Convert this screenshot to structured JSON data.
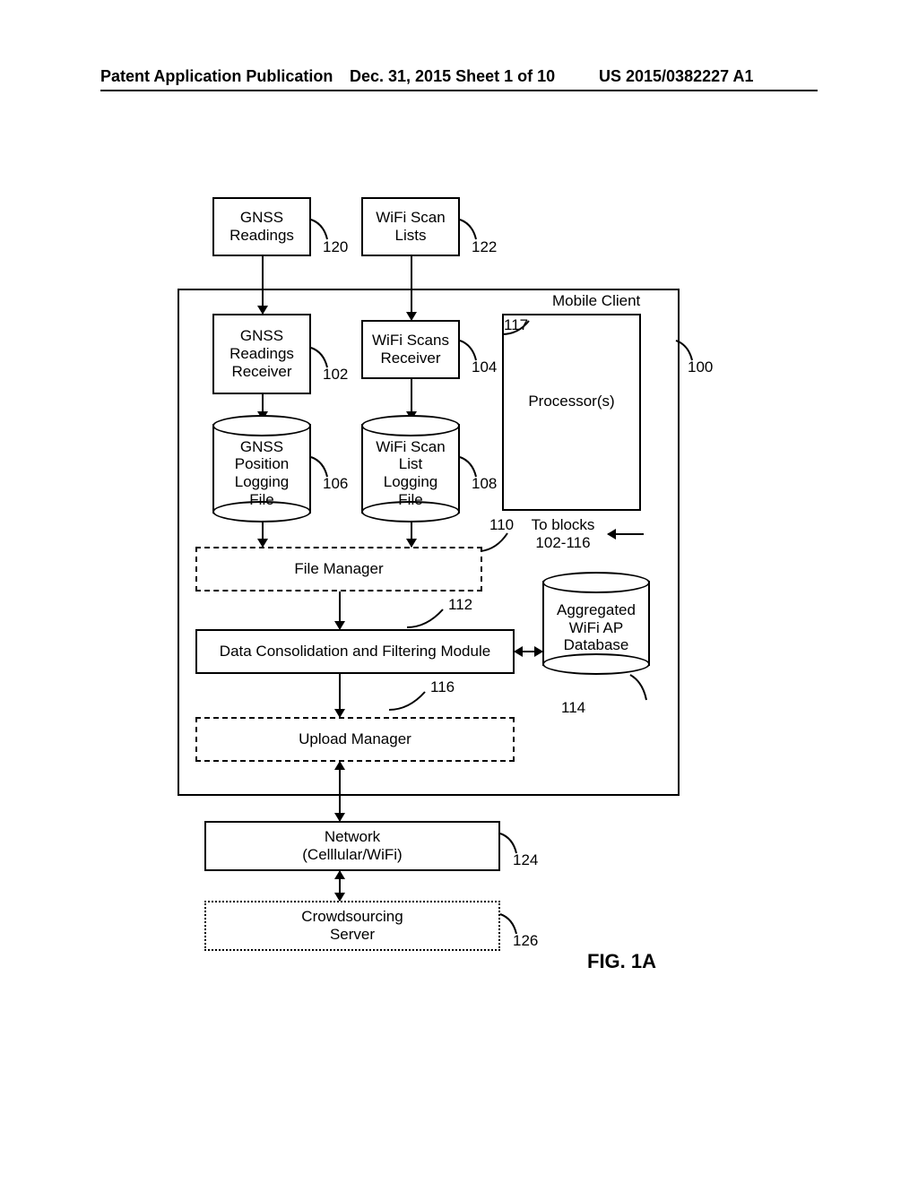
{
  "header": {
    "left": "Patent Application Publication",
    "mid": "Dec. 31, 2015   Sheet 1 of 10",
    "right": "US 2015/0382227 A1"
  },
  "blocks": {
    "gnss_readings": "GNSS\nReadings",
    "wifi_scan_lists": "WiFi Scan\nLists",
    "gnss_receiver": "GNSS\nReadings\nReceiver",
    "wifi_receiver": "WiFi Scans\nReceiver",
    "gnss_log": "GNSS\nPosition\nLogging\nFile",
    "wifi_log": "WiFi Scan\nList\nLogging\nFile",
    "file_manager": "File Manager",
    "consolidation": "Data Consolidation and Filtering Module",
    "upload_manager": "Upload Manager",
    "processors": "Processor(s)",
    "agg_db": "Aggregated\nWiFi AP\nDatabase",
    "network": "Network\n(Celllular/WiFi)",
    "crowd": "Crowdsourcing\nServer",
    "mobile_client": "Mobile Client",
    "to_blocks": "To blocks\n102-116"
  },
  "refs": {
    "r100": "100",
    "r102": "102",
    "r104": "104",
    "r106": "106",
    "r108": "108",
    "r110": "110",
    "r112": "112",
    "r114": "114",
    "r116": "116",
    "r117": "117",
    "r120": "120",
    "r122": "122",
    "r124": "124",
    "r126": "126"
  },
  "figure_label": "FIG. 1A"
}
